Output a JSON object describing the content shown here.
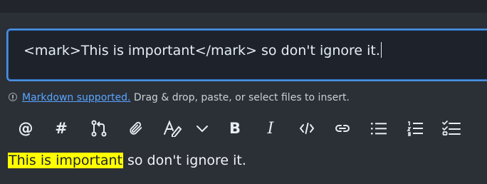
{
  "editor": {
    "value": "<mark>This is important</mark> so don't ignore it."
  },
  "hint": {
    "link_text": "Markdown supported.",
    "text": " Drag & drop, paste, or select files to insert."
  },
  "toolbar": {
    "items": [
      {
        "icon": "mention-icon",
        "glyph": "@"
      },
      {
        "icon": "reference-icon",
        "glyph": "#"
      },
      {
        "icon": "cross-reference-icon"
      },
      {
        "icon": "attach-icon"
      },
      {
        "icon": "text-style-icon"
      },
      {
        "icon": "chevron-down-icon"
      },
      {
        "icon": "bold-icon",
        "glyph": "B"
      },
      {
        "icon": "italic-icon",
        "glyph": "I"
      },
      {
        "icon": "code-icon"
      },
      {
        "icon": "link-icon"
      },
      {
        "icon": "bulleted-list-icon"
      },
      {
        "icon": "numbered-list-icon"
      },
      {
        "icon": "task-list-icon"
      }
    ]
  },
  "preview": {
    "highlighted": "This is important",
    "rest": " so don't ignore it."
  },
  "colors": {
    "focus_border": "#4a8fe0",
    "link": "#58a6ff",
    "highlight": "#ffff00"
  }
}
